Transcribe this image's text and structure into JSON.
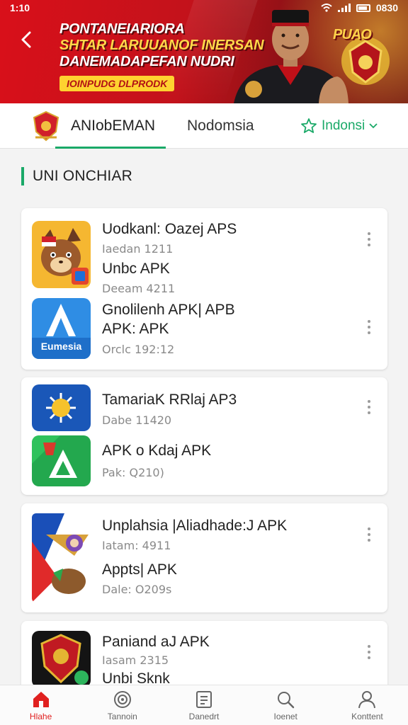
{
  "status_bar": {
    "time": "1:10",
    "battery": "0830"
  },
  "banner": {
    "lines": [
      "PONTANEIARIORA",
      "SHTAR LARUUANOF INERSAN",
      "DANEMADAPEFAN NUDRI"
    ],
    "tagline": "IOINPUDG DLPRODK",
    "badge": "PUAO"
  },
  "tabs": [
    {
      "label": "ANIobEMAN",
      "active": true
    },
    {
      "label": "Nodomsia",
      "active": false
    }
  ],
  "language": {
    "label": "Indonsi"
  },
  "section_title": "UNI ONCHIAR",
  "apps": [
    {
      "name": "Uodkanl: Oazej APS",
      "meta": "Iaedan 1211"
    },
    {
      "name": "Unbc APK",
      "meta": "Deeam 4211"
    },
    {
      "name": "Gnolilenh APK| APB",
      "name2": "APK: APK",
      "meta": "Orclc 192:12",
      "icon_text": "Eumesia"
    },
    {
      "name": "TamariaK RRlaj AP3",
      "meta": "Dabe 11420"
    },
    {
      "name": "APK o Kdaj APK",
      "meta": "Pak: Q210)"
    },
    {
      "name": "Unplahsia |Aliadhade:J APK",
      "meta": "Iatam: 4911"
    },
    {
      "name": "Appts| APK",
      "meta": "Dale: O209s"
    },
    {
      "name": "Paniand aJ APK",
      "meta": "Iasam 2315"
    },
    {
      "name": "Unbi Sknk",
      "meta": ""
    }
  ],
  "bottom_nav": [
    {
      "label": "Hlahe",
      "icon": "home-icon",
      "active": true
    },
    {
      "label": "Tannoin",
      "icon": "target-icon",
      "active": false
    },
    {
      "label": "Danedrt",
      "icon": "document-icon",
      "active": false
    },
    {
      "label": "Ioenet",
      "icon": "search-icon",
      "active": false
    },
    {
      "label": "Konttent",
      "icon": "user-icon",
      "active": false
    }
  ],
  "colors": {
    "accent": "#1aa968",
    "brand_red": "#d9101a",
    "active_nav": "#e0201f"
  }
}
